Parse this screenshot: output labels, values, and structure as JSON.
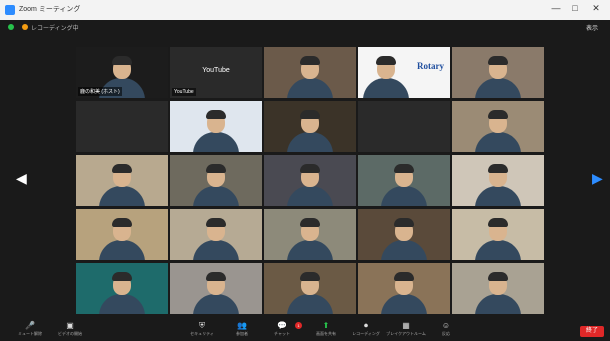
{
  "window": {
    "title": "Zoom ミーティング",
    "controls": [
      "—",
      "□",
      "✕"
    ]
  },
  "meeting": {
    "recording_label": "レコーディング中",
    "view_label": "表示"
  },
  "participants": [
    {
      "name": "鹿の和美 (ホスト)",
      "kind": "video",
      "bg": "#1c1c1c"
    },
    {
      "name": "YouTube",
      "kind": "text",
      "bg": "#2a2a2a",
      "center": "YouTube"
    },
    {
      "name": "",
      "kind": "video",
      "bg": "#6b5a4a"
    },
    {
      "name": "",
      "kind": "rotary",
      "bg": "#f5f5f5"
    },
    {
      "name": "",
      "kind": "video",
      "bg": "#8a7a6a"
    },
    {
      "name": "",
      "kind": "text",
      "bg": "#2a2a2a",
      "center": "",
      "center_name": ""
    },
    {
      "name": "",
      "kind": "video",
      "bg": "#dfe6ee",
      "active": true
    },
    {
      "name": "",
      "kind": "video",
      "bg": "#3b3328"
    },
    {
      "name": "",
      "kind": "text",
      "bg": "#2a2a2a",
      "center": ""
    },
    {
      "name": "",
      "kind": "video",
      "bg": "#9b8b75"
    },
    {
      "name": "",
      "kind": "video",
      "bg": "#b8a98f"
    },
    {
      "name": "",
      "kind": "video",
      "bg": "#6e6a5e"
    },
    {
      "name": "",
      "kind": "video",
      "bg": "#4a4a52"
    },
    {
      "name": "",
      "kind": "video",
      "bg": "#5c6a66"
    },
    {
      "name": "",
      "kind": "video",
      "bg": "#cfc6b8"
    },
    {
      "name": "",
      "kind": "video",
      "bg": "#b7a27d"
    },
    {
      "name": "",
      "kind": "video",
      "bg": "#b6aa94"
    },
    {
      "name": "",
      "kind": "video",
      "bg": "#8d8a7a"
    },
    {
      "name": "",
      "kind": "video",
      "bg": "#5a4a3a"
    },
    {
      "name": "",
      "kind": "video",
      "bg": "#c7bca6"
    },
    {
      "name": "",
      "kind": "video",
      "bg": "#1e6b6b"
    },
    {
      "name": "",
      "kind": "video",
      "bg": "#9a9590"
    },
    {
      "name": "",
      "kind": "video",
      "bg": "#6b5a45"
    },
    {
      "name": "",
      "kind": "video",
      "bg": "#8a7358"
    },
    {
      "name": "",
      "kind": "video",
      "bg": "#a9a293"
    }
  ],
  "toolbar": {
    "items": [
      {
        "icon": "mic",
        "label": "ミュート解除"
      },
      {
        "icon": "video",
        "label": "ビデオの開始"
      },
      {
        "icon": "security",
        "label": "セキュリティ"
      },
      {
        "icon": "participants",
        "label": "参加者"
      },
      {
        "icon": "chat",
        "label": "チャット"
      },
      {
        "icon": "share",
        "label": "画面を共有"
      },
      {
        "icon": "record",
        "label": "レコーディング"
      },
      {
        "icon": "breakout",
        "label": "ブレイクアウトルーム"
      },
      {
        "icon": "reactions",
        "label": "反応"
      }
    ],
    "chat_badge": "1",
    "end_label": "終了"
  }
}
